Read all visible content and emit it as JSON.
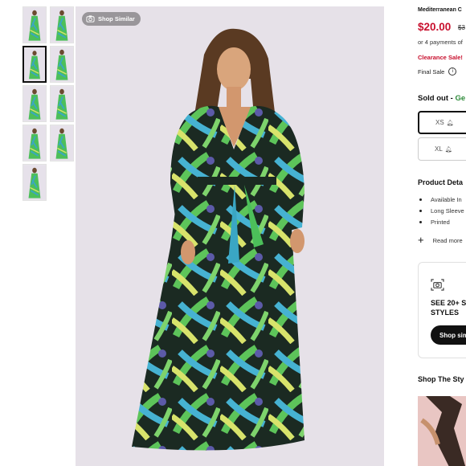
{
  "gallery": {
    "shop_similar_label": "Shop Similar",
    "thumbnails": [
      {
        "name": "thumb-1"
      },
      {
        "name": "thumb-2"
      },
      {
        "name": "thumb-3",
        "active": true
      },
      {
        "name": "thumb-4"
      },
      {
        "name": "thumb-5"
      },
      {
        "name": "thumb-6"
      },
      {
        "name": "thumb-7"
      },
      {
        "name": "thumb-8"
      },
      {
        "name": "thumb-9"
      }
    ],
    "main_image_icon": "camera-icon"
  },
  "product": {
    "title": "Mediterranean C",
    "price": "$20.00",
    "old_price": "$3",
    "payments": "or 4 payments of",
    "clearance": "Clearance Sale!",
    "final_sale": "Final Sale",
    "sold_out_prefix": "Sold out - ",
    "sold_out_suffix": "Ge",
    "sizes": [
      {
        "label": "XS",
        "selected": true,
        "icon": "bell-icon"
      },
      {
        "label": "XL",
        "selected": false,
        "icon": "bell-icon"
      }
    ],
    "details_heading": "Product Deta",
    "details": [
      "Available In",
      "Long Sleeve",
      "Printed"
    ],
    "read_more": "Read more"
  },
  "similar_card": {
    "text_line1": "SEE 20+ S",
    "text_line2": "STYLES",
    "button": "Shop sim"
  },
  "shop_the_style": "Shop The Sty",
  "colors": {
    "price_red": "#c8102e",
    "green": "#2e8b3a",
    "dress_green": "#4cbf5a",
    "dress_teal": "#3aa6c4",
    "dress_yellow": "#d9e36a"
  }
}
